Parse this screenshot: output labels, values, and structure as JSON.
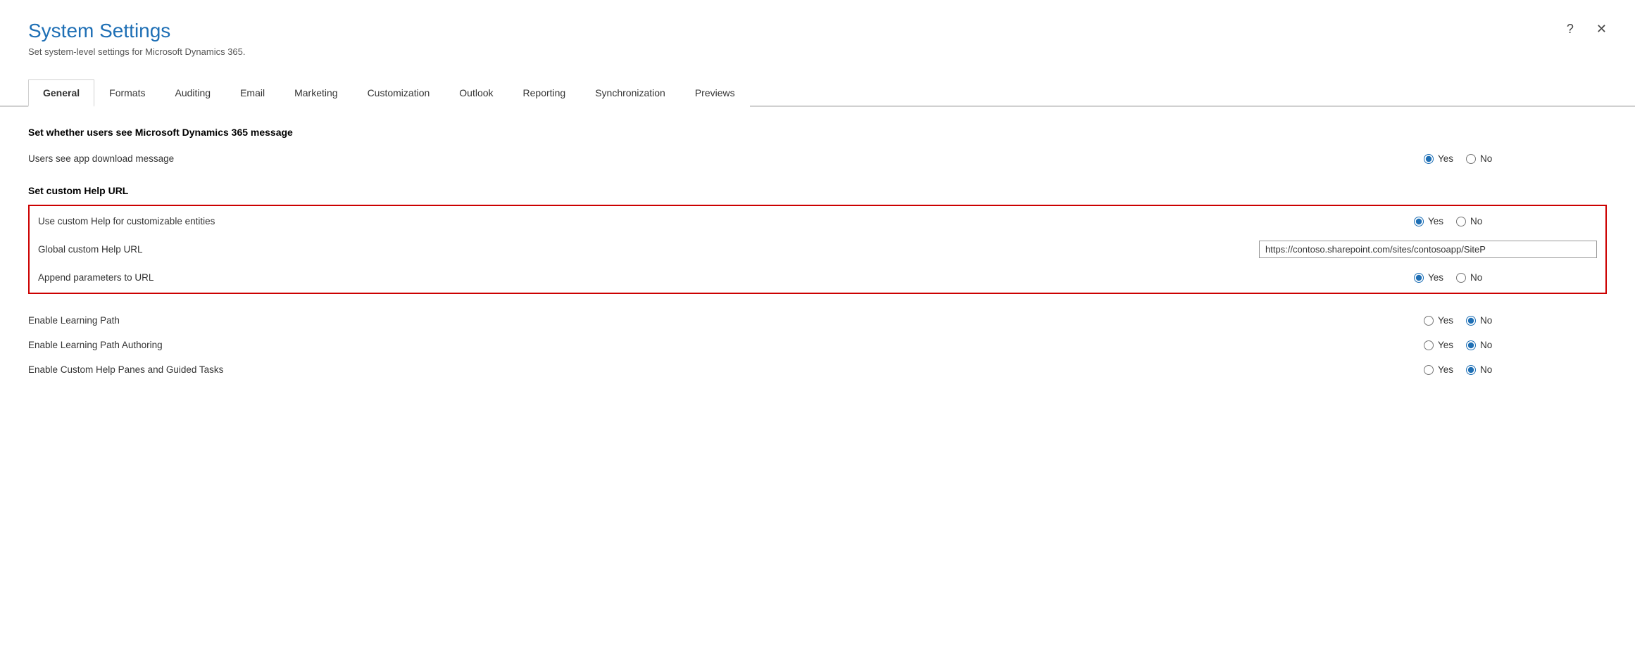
{
  "dialog": {
    "title": "System Settings",
    "subtitle": "Set system-level settings for Microsoft Dynamics 365.",
    "help_btn": "?",
    "close_btn": "✕"
  },
  "tabs": [
    {
      "id": "general",
      "label": "General",
      "active": true
    },
    {
      "id": "formats",
      "label": "Formats",
      "active": false
    },
    {
      "id": "auditing",
      "label": "Auditing",
      "active": false
    },
    {
      "id": "email",
      "label": "Email",
      "active": false
    },
    {
      "id": "marketing",
      "label": "Marketing",
      "active": false
    },
    {
      "id": "customization",
      "label": "Customization",
      "active": false
    },
    {
      "id": "outlook",
      "label": "Outlook",
      "active": false
    },
    {
      "id": "reporting",
      "label": "Reporting",
      "active": false
    },
    {
      "id": "synchronization",
      "label": "Synchronization",
      "active": false
    },
    {
      "id": "previews",
      "label": "Previews",
      "active": false
    }
  ],
  "sections": {
    "dynamics_message": {
      "title": "Set whether users see Microsoft Dynamics 365 message",
      "rows": [
        {
          "label": "Users see app download message",
          "type": "radio",
          "yes_checked": true,
          "no_checked": false
        }
      ]
    },
    "custom_help": {
      "title": "Set custom Help URL",
      "highlighted": true,
      "rows": [
        {
          "label": "Use custom Help for customizable entities",
          "type": "radio",
          "yes_checked": true,
          "no_checked": false
        },
        {
          "label": "Global custom Help URL",
          "type": "text",
          "value": "https://contoso.sharepoint.com/sites/contosoapp/SiteP"
        },
        {
          "label": "Append parameters to URL",
          "type": "radio",
          "yes_checked": true,
          "no_checked": false
        }
      ]
    },
    "learning": {
      "title": "",
      "highlighted": false,
      "rows": [
        {
          "label": "Enable Learning Path",
          "type": "radio",
          "yes_checked": false,
          "no_checked": true
        },
        {
          "label": "Enable Learning Path Authoring",
          "type": "radio",
          "yes_checked": false,
          "no_checked": true
        },
        {
          "label": "Enable Custom Help Panes and Guided Tasks",
          "type": "radio",
          "yes_checked": false,
          "no_checked": true
        }
      ]
    }
  },
  "labels": {
    "yes": "Yes",
    "no": "No"
  }
}
